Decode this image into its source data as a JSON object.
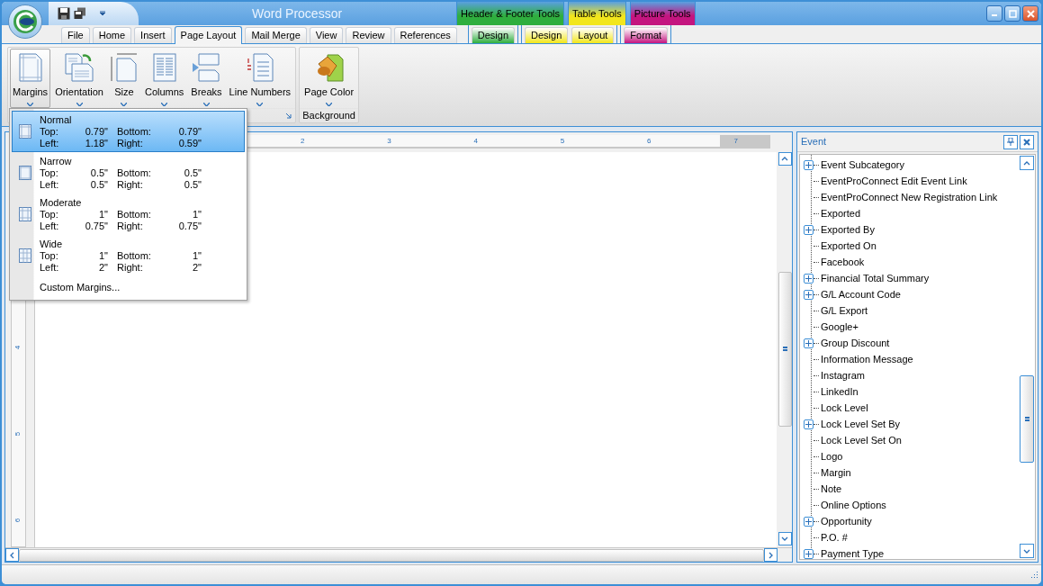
{
  "window": {
    "title": "Word Processor"
  },
  "context_groups": [
    {
      "title": "Header & Footer Tools",
      "color": "#2fae3e",
      "tabs": [
        {
          "label": "Design",
          "selected": false
        }
      ]
    },
    {
      "title": "Table Tools",
      "color": "#f2e61c",
      "tabs": [
        {
          "label": "Design",
          "selected": false
        },
        {
          "label": "Layout",
          "selected": false
        }
      ]
    },
    {
      "title": "Picture Tools",
      "color": "#c4157f",
      "tabs": [
        {
          "label": "Format",
          "selected": false
        }
      ]
    }
  ],
  "tabs": [
    {
      "label": "File",
      "selected": false
    },
    {
      "label": "Home",
      "selected": false
    },
    {
      "label": "Insert",
      "selected": false
    },
    {
      "label": "Page Layout",
      "selected": true
    },
    {
      "label": "Mail Merge",
      "selected": false
    },
    {
      "label": "View",
      "selected": false
    },
    {
      "label": "Review",
      "selected": false
    },
    {
      "label": "References",
      "selected": false
    }
  ],
  "ribbon_groups": [
    {
      "buttons": [
        {
          "kind": "margins",
          "label": "Margins",
          "open": true
        },
        {
          "kind": "orientation",
          "label": "Orientation",
          "open": false
        },
        {
          "kind": "size",
          "label": "Size",
          "open": false
        },
        {
          "kind": "columns",
          "label": "Columns",
          "open": false
        },
        {
          "kind": "breaks",
          "label": "Breaks",
          "open": false
        },
        {
          "kind": "line_numbers",
          "label": "Line Numbers",
          "open": false
        }
      ]
    },
    {
      "label": "Background",
      "buttons": [
        {
          "kind": "page_color",
          "label": "Page Color",
          "open": false
        }
      ]
    }
  ],
  "margins_menu": {
    "items": [
      {
        "name": "Normal",
        "selected": true,
        "kind": "normal",
        "fields": [
          {
            "label": "Top:",
            "value": "0.79\""
          },
          {
            "label": "Bottom:",
            "value": "0.79\""
          },
          {
            "label": "Left:",
            "value": "1.18\""
          },
          {
            "label": "Right:",
            "value": "0.59\""
          }
        ]
      },
      {
        "name": "Narrow",
        "selected": false,
        "kind": "narrow",
        "fields": [
          {
            "label": "Top:",
            "value": "0.5\""
          },
          {
            "label": "Bottom:",
            "value": "0.5\""
          },
          {
            "label": "Left:",
            "value": "0.5\""
          },
          {
            "label": "Right:",
            "value": "0.5\""
          }
        ]
      },
      {
        "name": "Moderate",
        "selected": false,
        "kind": "moderate",
        "fields": [
          {
            "label": "Top:",
            "value": "1\""
          },
          {
            "label": "Bottom:",
            "value": "1\""
          },
          {
            "label": "Left:",
            "value": "0.75\""
          },
          {
            "label": "Right:",
            "value": "0.75\""
          }
        ]
      },
      {
        "name": "Wide",
        "selected": false,
        "kind": "wide",
        "fields": [
          {
            "label": "Top:",
            "value": "1\""
          },
          {
            "label": "Bottom:",
            "value": "1\""
          },
          {
            "label": "Left:",
            "value": "2\""
          },
          {
            "label": "Right:",
            "value": "2\""
          }
        ]
      }
    ],
    "custom": "Custom Margins..."
  },
  "ruler": {
    "horizontal": [
      "2",
      "3",
      "4",
      "5",
      "6",
      "7"
    ],
    "vertical": [
      "4",
      "5",
      "6"
    ]
  },
  "panel": {
    "title": "Event",
    "items": [
      {
        "label": "Event Subcategory",
        "kind": "group"
      },
      {
        "label": "EventProConnect Edit Event Link",
        "kind": "field"
      },
      {
        "label": "EventProConnect New Registration Link",
        "kind": "field"
      },
      {
        "label": "Exported",
        "kind": "field"
      },
      {
        "label": "Exported By",
        "kind": "group"
      },
      {
        "label": "Exported On",
        "kind": "field"
      },
      {
        "label": "Facebook",
        "kind": "field"
      },
      {
        "label": "Financial Total Summary",
        "kind": "group"
      },
      {
        "label": "G/L Account Code",
        "kind": "group"
      },
      {
        "label": "G/L Export",
        "kind": "field"
      },
      {
        "label": "Google+",
        "kind": "field"
      },
      {
        "label": "Group Discount",
        "kind": "group"
      },
      {
        "label": "Information Message",
        "kind": "field"
      },
      {
        "label": "Instagram",
        "kind": "field"
      },
      {
        "label": "LinkedIn",
        "kind": "field"
      },
      {
        "label": "Lock Level",
        "kind": "field"
      },
      {
        "label": "Lock Level Set By",
        "kind": "group"
      },
      {
        "label": "Lock Level Set On",
        "kind": "field"
      },
      {
        "label": "Logo",
        "kind": "field"
      },
      {
        "label": "Margin",
        "kind": "field"
      },
      {
        "label": "Note",
        "kind": "field"
      },
      {
        "label": "Online Options",
        "kind": "field"
      },
      {
        "label": "Opportunity",
        "kind": "group"
      },
      {
        "label": "P.O. #",
        "kind": "field"
      },
      {
        "label": "Payment Type",
        "kind": "group"
      }
    ]
  }
}
